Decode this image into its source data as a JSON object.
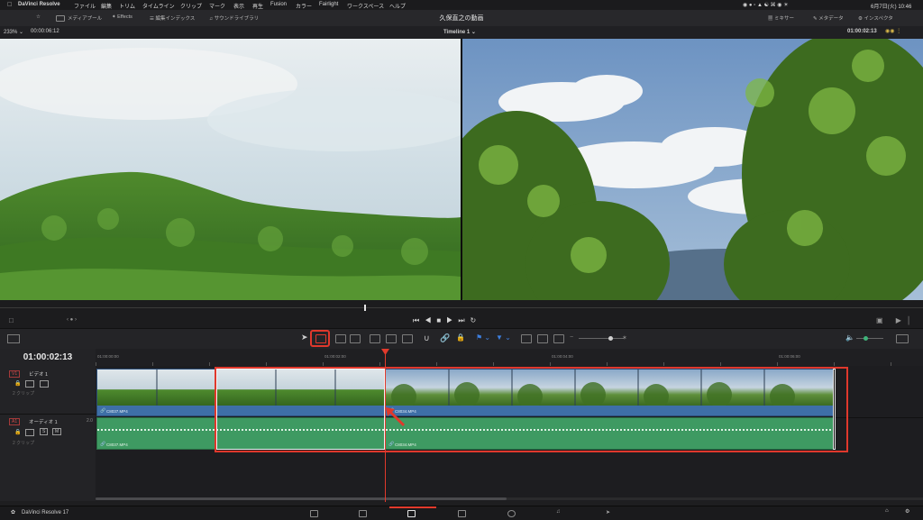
{
  "menubar": {
    "app_name": "DaVinci Resolve",
    "items": [
      "ファイル",
      "編集",
      "トリム",
      "タイムライン",
      "クリップ",
      "マーク",
      "表示",
      "再生",
      "Fusion",
      "カラー",
      "Fairlight",
      "ワークスペース",
      "ヘルプ"
    ],
    "datetime": "6月7日(火)  10:46"
  },
  "toolbar": {
    "media_pool": "メディアプール",
    "effects": "Effects",
    "edit_index": "編集インデックス",
    "sound_library": "サウンドライブラリ",
    "project_title": "久保直之の動画",
    "mixer": "ミキサー",
    "metadata": "メタデータ",
    "inspector": "インスペクタ"
  },
  "viewer": {
    "zoom": "233%",
    "source_timecode": "00:00:06:12",
    "timeline_name": "Timeline 1",
    "record_timecode": "01:00:02:13"
  },
  "timeline": {
    "current_timecode": "01:00:02:13",
    "ruler_labels": [
      "01:00:00:00",
      "01:00:02:00",
      "01:00:04:00",
      "01:00:06:00"
    ],
    "tracks": {
      "video": {
        "id": "V1",
        "name": "ビデオ 1",
        "clip_count": "2 クリップ"
      },
      "audio": {
        "id": "A1",
        "name": "オーディオ 1",
        "channel": "2.0",
        "clip_count": "2 クリップ",
        "solo": "S",
        "mute": "M"
      }
    },
    "clips": {
      "video": [
        "C8037.MP4",
        "C8034.MP4"
      ],
      "audio": [
        "C8037.MP4",
        "C8034.MP4"
      ]
    }
  },
  "footer": {
    "app_label": "DaVinci Resolve 17"
  },
  "colors": {
    "accent_red": "#e0382c",
    "video_clip": "#3e6fa7",
    "audio_clip": "#3e9a62",
    "playhead": "#e23a2c"
  },
  "icons": [
    "link-icon",
    "pointer-icon",
    "blade-icon",
    "snap-icon",
    "lock-icon",
    "flag-icon",
    "marker-icon",
    "zoom-icon",
    "volume-icon",
    "play-icon",
    "stop-icon",
    "loop-icon",
    "home-icon",
    "gear-icon"
  ]
}
